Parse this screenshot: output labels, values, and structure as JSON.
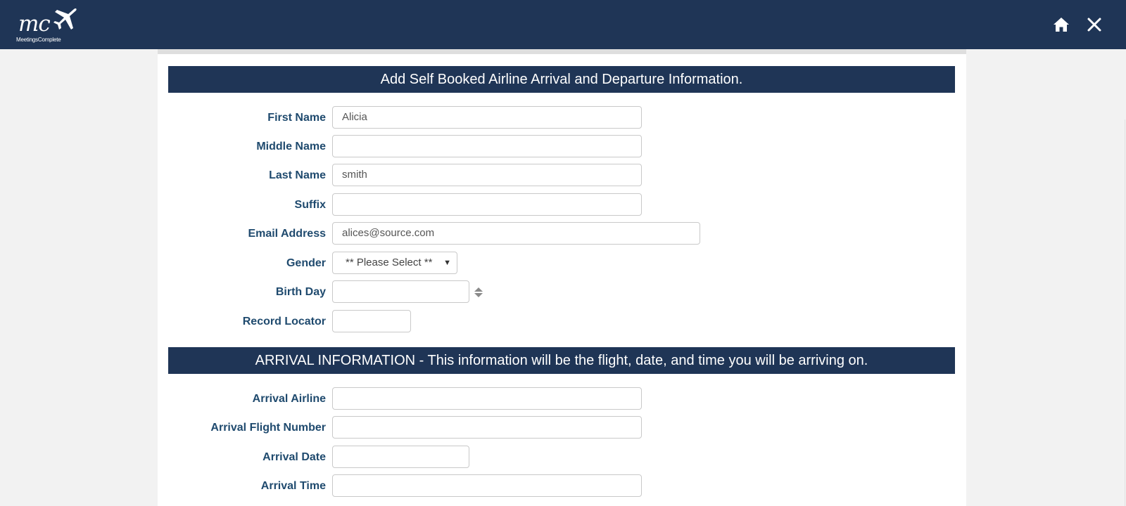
{
  "app": {
    "logo_mark": "mc",
    "logo_tagline": "MeetingsComplete"
  },
  "colors": {
    "navy": "#1f3556",
    "label_blue": "#1f4a6e",
    "page_bg": "#f2f2f2"
  },
  "nav": {
    "home_icon": "home-icon",
    "close_icon": "close-icon"
  },
  "form": {
    "title": "Add Self Booked Airline Arrival and Departure Information.",
    "fields": {
      "first_name": {
        "label": "First Name",
        "value": "Alicia"
      },
      "middle_name": {
        "label": "Middle Name",
        "value": ""
      },
      "last_name": {
        "label": "Last Name",
        "value": "smith"
      },
      "suffix": {
        "label": "Suffix",
        "value": ""
      },
      "email": {
        "label": "Email Address",
        "value": "alices@source.com"
      },
      "gender": {
        "label": "Gender",
        "selected": "** Please Select **"
      },
      "birth_day": {
        "label": "Birth Day",
        "value": ""
      },
      "record_locator": {
        "label": "Record Locator",
        "value": ""
      }
    }
  },
  "arrival": {
    "title": "ARRIVAL INFORMATION - This information will be the flight, date, and time you will be arriving on.",
    "fields": {
      "airline": {
        "label": "Arrival Airline",
        "value": ""
      },
      "flight_number": {
        "label": "Arrival Flight Number",
        "value": ""
      },
      "date": {
        "label": "Arrival Date",
        "value": ""
      },
      "time": {
        "label": "Arrival Time",
        "value": ""
      }
    }
  }
}
